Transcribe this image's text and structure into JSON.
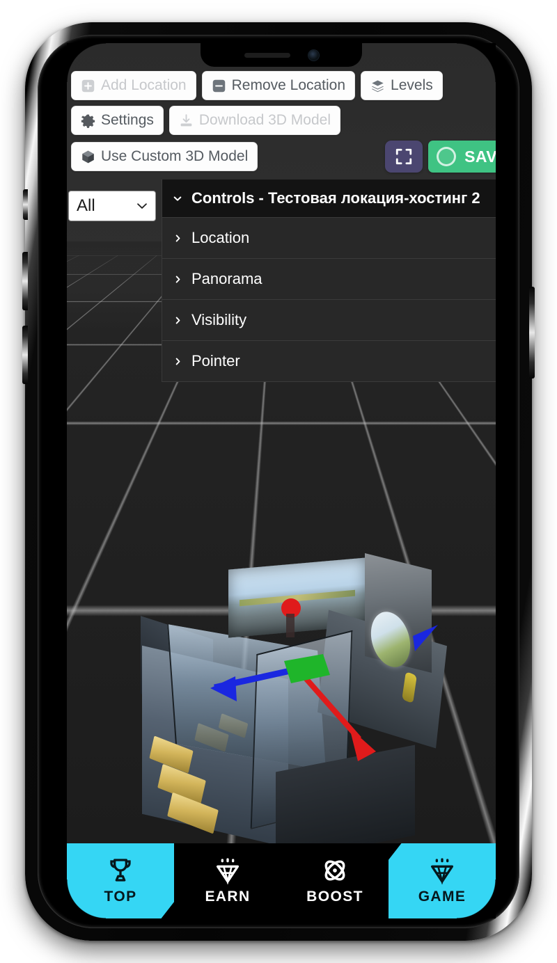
{
  "toolbar": {
    "rows": [
      [
        {
          "id": "add-location",
          "label": "Add Location",
          "icon": "plus-square-icon",
          "disabled": true
        },
        {
          "id": "remove-location",
          "label": "Remove Location",
          "icon": "minus-square-icon",
          "disabled": false
        },
        {
          "id": "levels",
          "label": "Levels",
          "icon": "layers-icon",
          "disabled": false
        }
      ],
      [
        {
          "id": "settings",
          "label": "Settings",
          "icon": "gear-icon",
          "disabled": false
        },
        {
          "id": "download-3d-model",
          "label": "Download 3D Model",
          "icon": "download-icon",
          "disabled": true
        }
      ],
      [
        {
          "id": "use-custom-3d-model",
          "label": "Use Custom 3D Model",
          "icon": "cube-icon",
          "disabled": false
        }
      ]
    ],
    "fullscreen_label": "fullscreen",
    "save_label": "SAVE"
  },
  "filter": {
    "value": "All",
    "options": [
      "All"
    ]
  },
  "controls_panel": {
    "header": {
      "label": "Controls - Тестовая локация-хостинг 2",
      "expanded": true,
      "chevron": "chevron-down-icon"
    },
    "rows": [
      {
        "label": "Location",
        "expanded": false,
        "chevron": "chevron-right-icon"
      },
      {
        "label": "Panorama",
        "expanded": false,
        "chevron": "chevron-right-icon"
      },
      {
        "label": "Visibility",
        "expanded": false,
        "chevron": "chevron-right-icon"
      },
      {
        "label": "Pointer",
        "expanded": false,
        "chevron": "chevron-right-icon"
      }
    ]
  },
  "bottom_nav": {
    "items": [
      {
        "label": "TOP",
        "icon": "trophy-icon",
        "active": true
      },
      {
        "label": "EARN",
        "icon": "diamond-icon",
        "active": false
      },
      {
        "label": "BOOST",
        "icon": "atom-icon",
        "active": false
      },
      {
        "label": "GAME",
        "icon": "diamond-icon",
        "active": true
      }
    ]
  },
  "viewport": {
    "name": "3d-scene-viewport",
    "gizmo": {
      "axes": [
        {
          "name": "y-axis-handle",
          "color": "#e01b1b",
          "shape": "dot"
        },
        {
          "name": "x-axis-arrow",
          "color": "#1a27e0",
          "shape": "arrow-left"
        },
        {
          "name": "z-axis-arrow",
          "color": "#e01b1b",
          "shape": "arrow-down-right"
        },
        {
          "name": "plane-handle",
          "color": "#1fb52a",
          "shape": "quad"
        },
        {
          "name": "x-axis-arrow-secondary",
          "color": "#1a27e0",
          "shape": "arrow-right"
        }
      ]
    }
  },
  "colors": {
    "accent_cyan": "#35d6f4",
    "save_green": "#3fc383",
    "fullscreen_purple": "#4b4670",
    "panel_header_bg": "#131313",
    "panel_row_bg": "#282828",
    "nav_bg": "#000000"
  }
}
